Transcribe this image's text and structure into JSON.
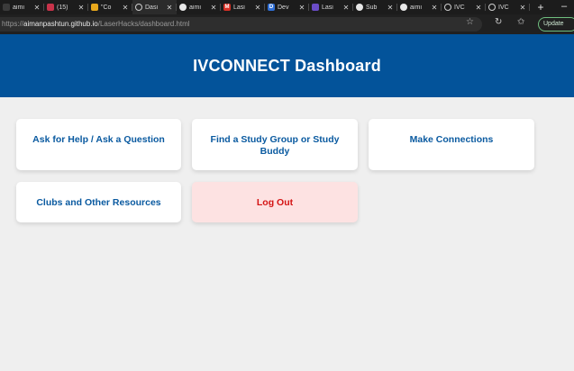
{
  "browser": {
    "tabs": [
      {
        "label": "aimı",
        "icon": "person-icon",
        "color": "#3b3b3b",
        "active": false
      },
      {
        "label": "(15)",
        "icon": "notification-icon",
        "color": "#c8334a",
        "active": false
      },
      {
        "label": "\"Co",
        "icon": "note-icon",
        "color": "#e8a81c",
        "active": false
      },
      {
        "label": "Dasi",
        "icon": "globe-icon",
        "color": "#555555",
        "active": true
      },
      {
        "label": "aimı",
        "icon": "github-icon",
        "color": "#111111",
        "active": false
      },
      {
        "label": "Lasi",
        "icon": "gmail-icon",
        "color": "#d93025",
        "active": false
      },
      {
        "label": "Dev",
        "icon": "dev-icon",
        "color": "#2f6fd6",
        "active": false
      },
      {
        "label": "Lasi",
        "icon": "app-icon",
        "color": "#6a4cc6",
        "active": false
      },
      {
        "label": "Sub",
        "icon": "chatgpt-icon",
        "color": "#555555",
        "active": false
      },
      {
        "label": "aimı",
        "icon": "github-icon",
        "color": "#111111",
        "active": false
      },
      {
        "label": "IVC",
        "icon": "globe-icon",
        "color": "#555555",
        "active": false
      },
      {
        "label": "IVC",
        "icon": "globe-icon",
        "color": "#555555",
        "active": false
      }
    ],
    "new_tab_label": "+",
    "window_control": "–",
    "url_prefix": "https://",
    "url_host": "aimanpashtun.github.io",
    "url_path": "/LaserHacks/dashboard.html",
    "update_label": "Update"
  },
  "page": {
    "title": "IVCONNECT Dashboard",
    "header_color": "#03539a",
    "cards": [
      {
        "label": "Ask for Help / Ask a Question"
      },
      {
        "label": "Find a Study Group or Study Buddy"
      },
      {
        "label": "Make Connections"
      },
      {
        "label": "Clubs and Other Resources"
      },
      {
        "label": "Log Out"
      }
    ]
  }
}
